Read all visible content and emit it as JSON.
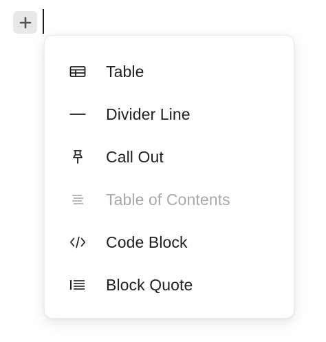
{
  "insert_button": {
    "icon": "plus-icon"
  },
  "menu": {
    "items": [
      {
        "label": "Table",
        "icon": "table-icon",
        "enabled": true
      },
      {
        "label": "Divider Line",
        "icon": "divider-icon",
        "enabled": true
      },
      {
        "label": "Call Out",
        "icon": "pin-icon",
        "enabled": true
      },
      {
        "label": "Table of Contents",
        "icon": "table-of-contents-icon",
        "enabled": false
      },
      {
        "label": "Code Block",
        "icon": "code-icon",
        "enabled": true
      },
      {
        "label": "Block Quote",
        "icon": "block-quote-icon",
        "enabled": true
      }
    ]
  },
  "colors": {
    "text": "#1f1f1f",
    "disabled_text": "#a8a8a8",
    "button_bg": "#e8e8e8"
  }
}
